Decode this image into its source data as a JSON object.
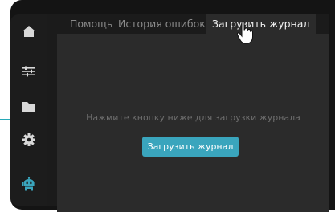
{
  "sidebar": {
    "items": [
      {
        "icon": "home-icon",
        "active": false
      },
      {
        "icon": "sliders-icon",
        "active": false
      },
      {
        "icon": "folder-icon",
        "active": false
      },
      {
        "icon": "gear-icon",
        "active": false
      },
      {
        "icon": "robot-icon",
        "active": true
      }
    ]
  },
  "tabs": [
    {
      "label": "Помощь",
      "active": false
    },
    {
      "label": "История ошибок",
      "active": false
    },
    {
      "label": "Загрузить журнал",
      "active": true
    }
  ],
  "content": {
    "hint": "Нажмите кнопку ниже для загрузки журнала",
    "button_label": "Загрузить журнал"
  },
  "colors": {
    "accent": "#3aa5bd",
    "background": "#141414",
    "panel": "#2b2b2b",
    "icon_inactive": "#d8d8d8"
  }
}
